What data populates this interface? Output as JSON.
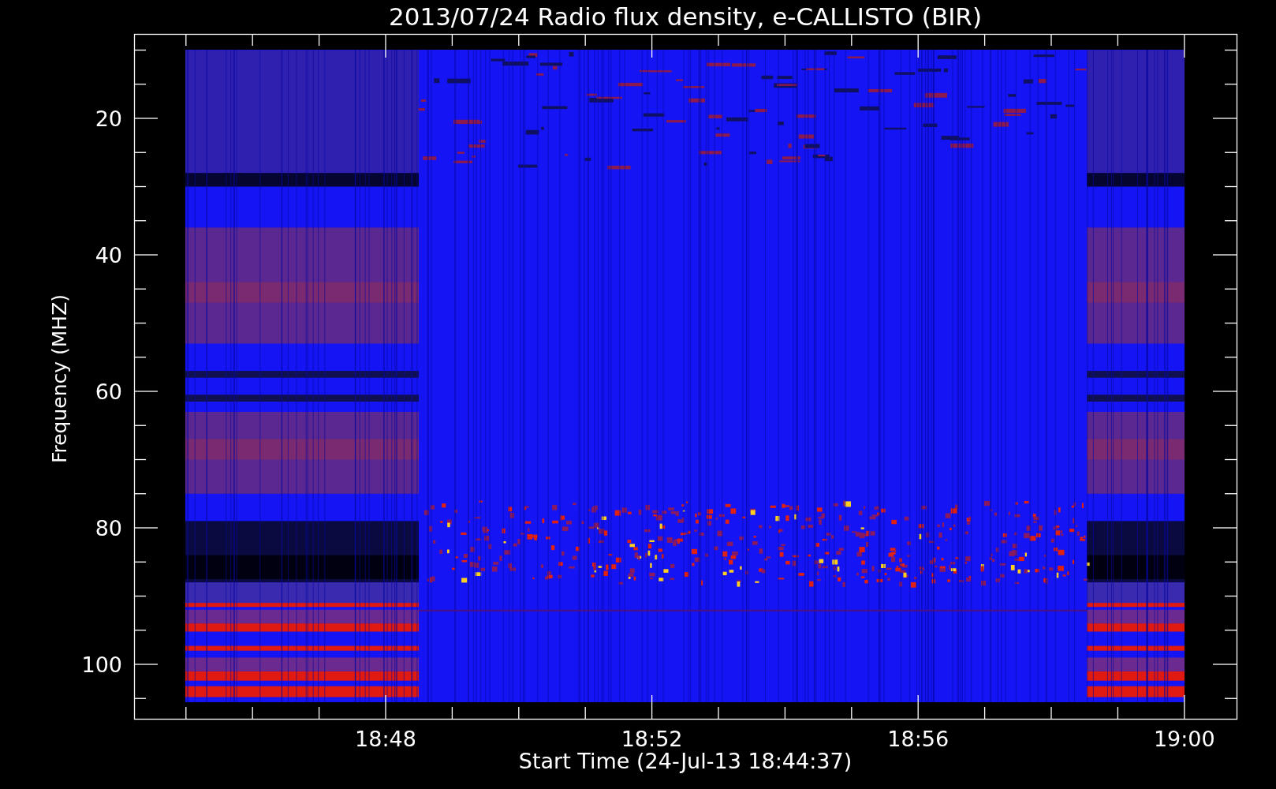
{
  "plot": {
    "title": "2013/07/24  Radio flux density, e-CALLISTO (BIR)",
    "ylabel": "Frequency (MHZ)",
    "xlabel": "Start Time (24-Jul-13 18:44:37)",
    "yticks": [
      "20",
      "40",
      "60",
      "80",
      "100"
    ],
    "xticks": [
      "18:48",
      "18:52",
      "18:56",
      "19:00"
    ]
  }
}
